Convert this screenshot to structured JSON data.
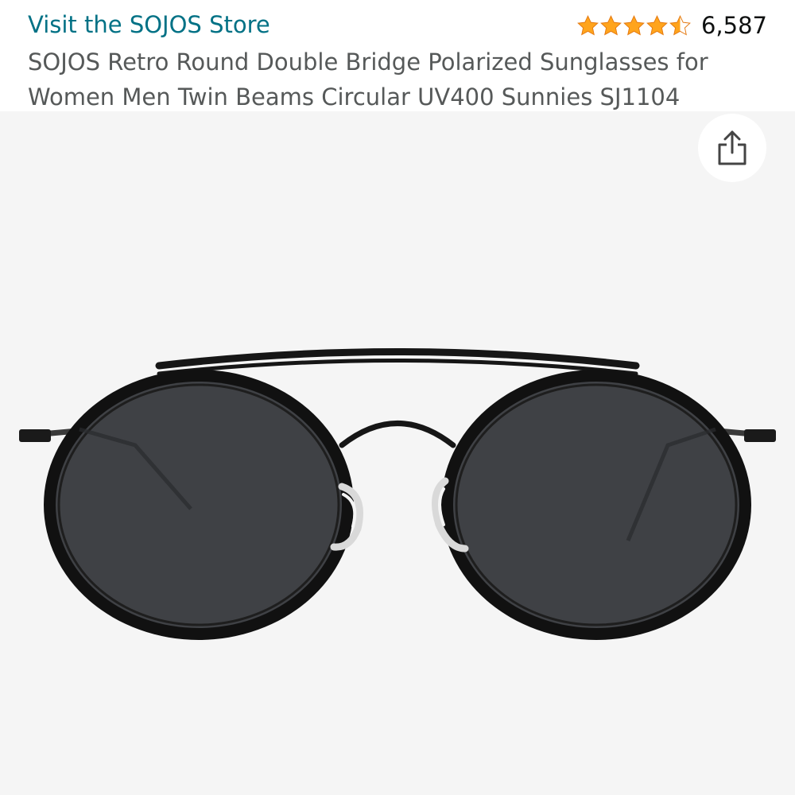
{
  "header": {
    "store_link": "Visit the SOJOS Store",
    "rating": {
      "value": 4.5,
      "max": 5,
      "count": "6,587",
      "star_color": "#FFA41C"
    },
    "title": "SOJOS Retro Round Double Bridge Polarized Sunglasses for Women Men Twin Beams Circular UV400 Sunnies SJ1104"
  },
  "gallery": {
    "background": "#f5f5f5",
    "share_icon": "share-icon",
    "image": "round double-bridge sunglasses, black frame, grey lenses"
  }
}
